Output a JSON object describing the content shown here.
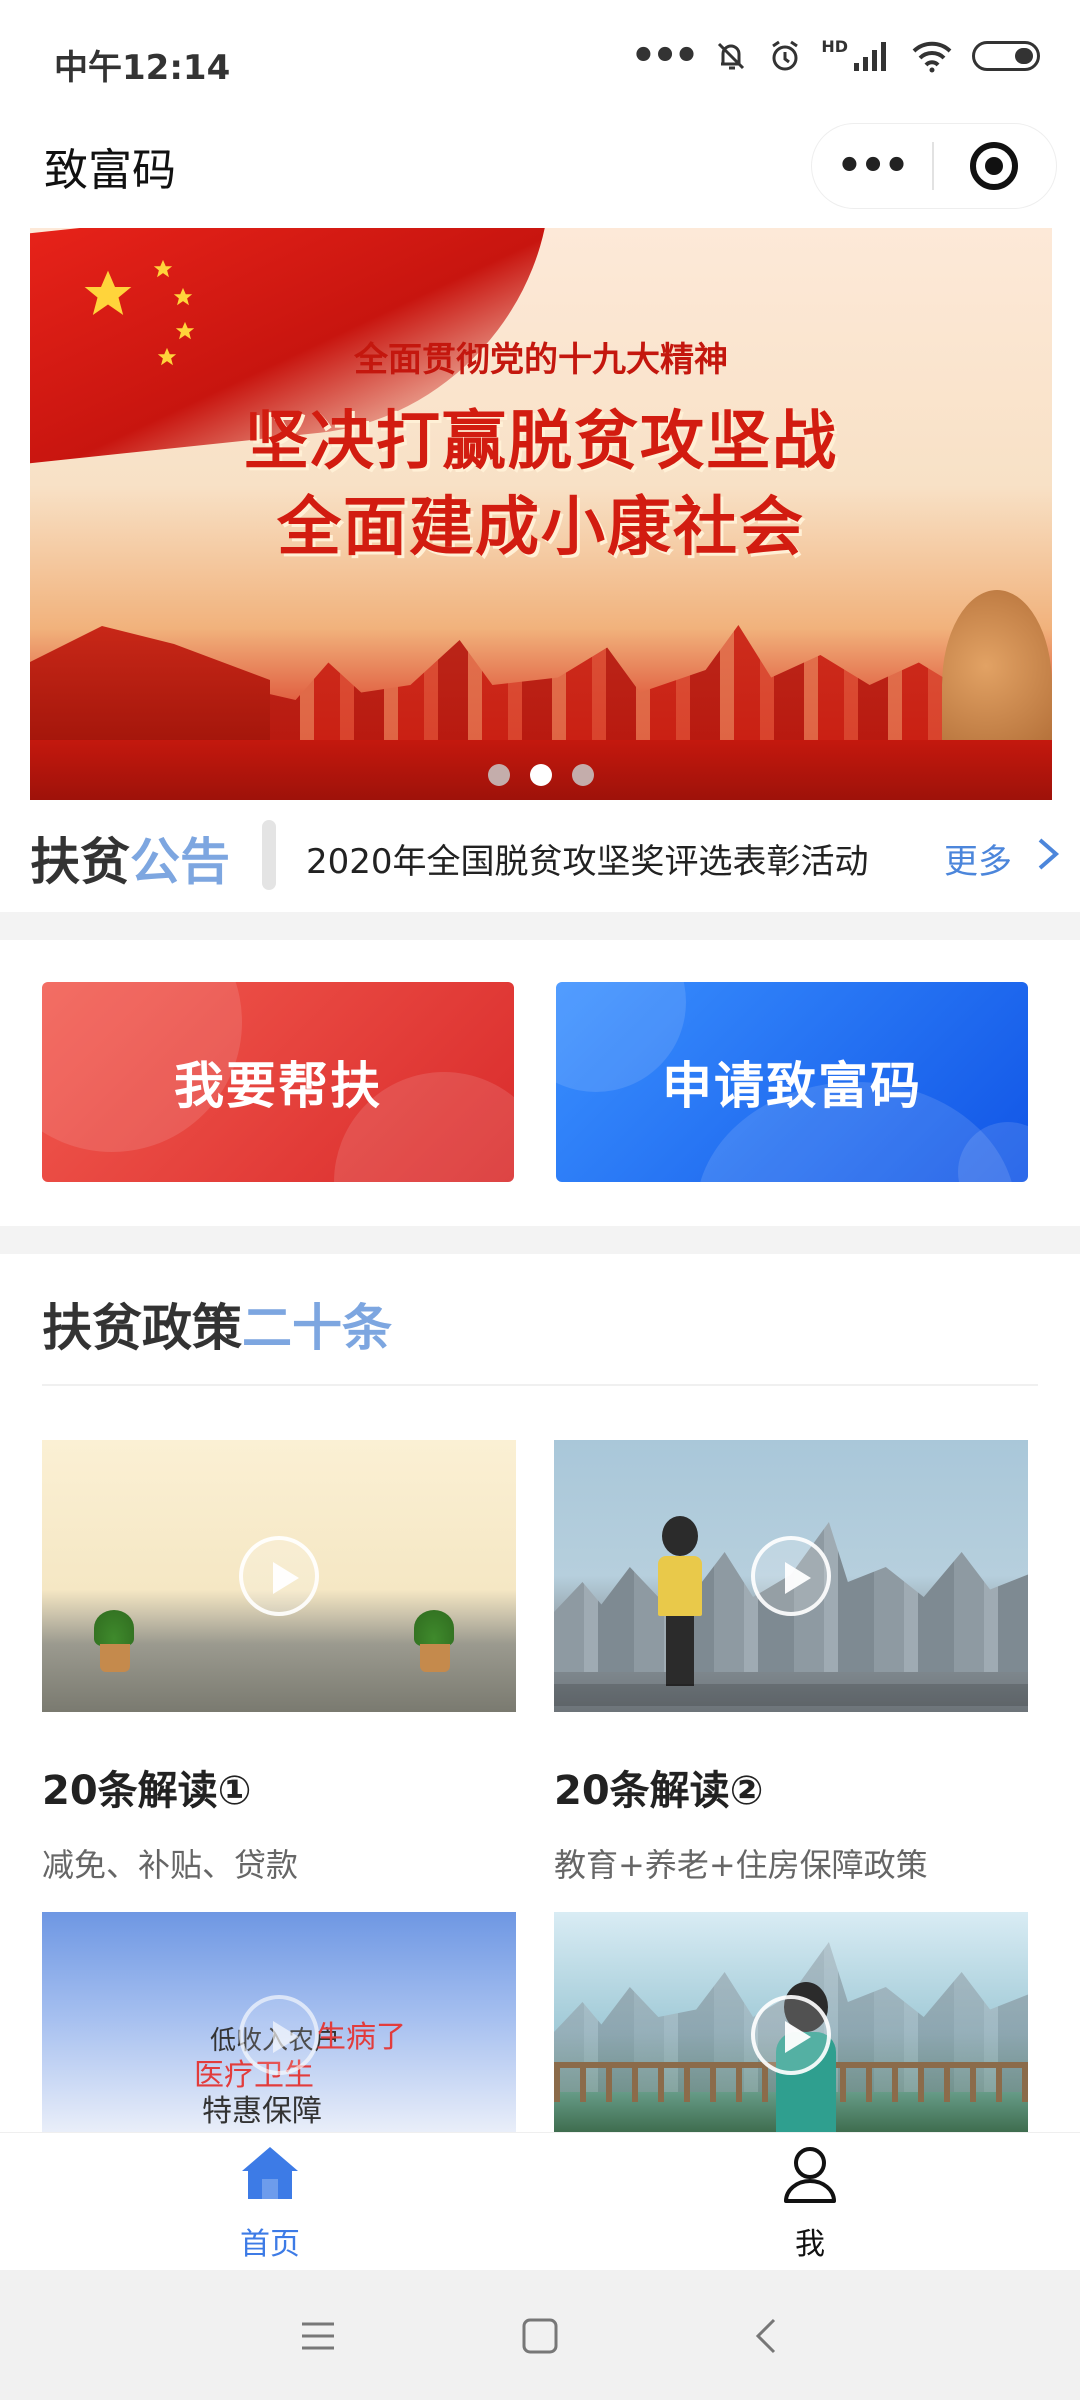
{
  "status_bar": {
    "time": "中午12:14",
    "icons": [
      "more-dots-icon",
      "mute-icon",
      "alarm-icon",
      "signal-icon",
      "wifi-icon",
      "battery-icon"
    ],
    "network_label": "HD"
  },
  "nav": {
    "title": "致富码",
    "more_icon": "more-dots-icon",
    "close_icon": "target-icon"
  },
  "banner": {
    "subtitle": "全面贯彻党的十九大精神",
    "line1": "坚决打赢脱贫攻坚战",
    "line2": "全面建成小康社会",
    "pagination": {
      "count": 3,
      "active_index": 1
    }
  },
  "notice": {
    "tag_prefix": "扶贫",
    "tag_highlight": "公告",
    "text": "2020年全国脱贫攻坚奖评选表彰活动",
    "more_label": "更多"
  },
  "actions": {
    "help_label": "我要帮扶",
    "apply_label": "申请致富码"
  },
  "policy": {
    "title_prefix": "扶贫政策",
    "title_highlight": "二十条",
    "videos": [
      {
        "title": "20条解读①",
        "desc": "减免、补贴、贷款"
      },
      {
        "title": "20条解读②",
        "desc": "教育+养老+住房保障政策"
      },
      {
        "overlay_a": "低收入农户",
        "overlay_b": "生病了",
        "overlay_c": "医疗卫生",
        "overlay_d": "特惠保障"
      },
      {}
    ]
  },
  "tabs": {
    "home_label": "首页",
    "me_label": "我",
    "active_color": "#3d7be6"
  },
  "colors": {
    "highlight_blue": "#7da6e0",
    "card_red": "#e23b36",
    "card_blue": "#1f6ff2",
    "banner_red": "#d21c10"
  }
}
